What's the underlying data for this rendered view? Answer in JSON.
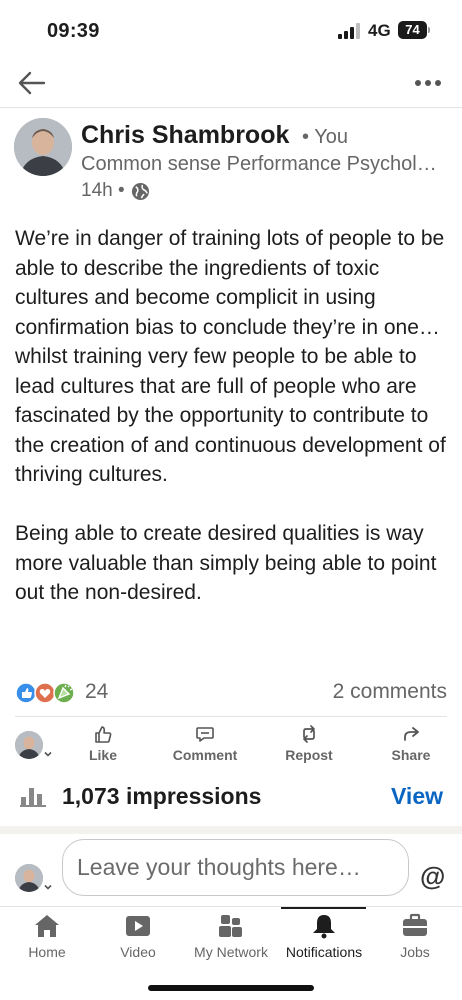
{
  "status_bar": {
    "time": "09:39",
    "network": "4G",
    "battery": "74"
  },
  "nav": {
    "back_icon": "arrow-left-icon",
    "more_icon": "ellipsis-icon"
  },
  "post": {
    "author": "Chris Shambrook",
    "degree": "• You",
    "headline": "Common sense Performance Psychology",
    "time_ago": "14h •",
    "visibility_icon": "globe-icon",
    "body": "We’re in danger of training lots of people to be able to describe the ingredients of toxic cultures and become complicit in using confirmation bias to conclude they’re in one… whilst training very few people to be able to lead cultures that are full of people who are fascinated by the opportunity to contribute to the creation of and continuous development of thriving cultures.\n\nBeing able to create desired qualities is way more valuable than simply being able to point out the non-desired."
  },
  "social": {
    "reaction_count": "24",
    "comments": "2 comments",
    "reaction_icons": [
      "like-icon",
      "love-icon",
      "celebrate-icon"
    ]
  },
  "actions": {
    "like": "Like",
    "comment": "Comment",
    "repost": "Repost",
    "share": "Share"
  },
  "impressions": {
    "text": "1,073 impressions",
    "view": "View"
  },
  "comment_box": {
    "placeholder": "Leave your thoughts here…",
    "mention": "@"
  },
  "tabs": {
    "home": "Home",
    "video": "Video",
    "network": "My Network",
    "notifications": "Notifications",
    "jobs": "Jobs"
  },
  "colors": {
    "accent": "#0a66c2",
    "text": "#1d1d1d",
    "muted": "#666666"
  }
}
